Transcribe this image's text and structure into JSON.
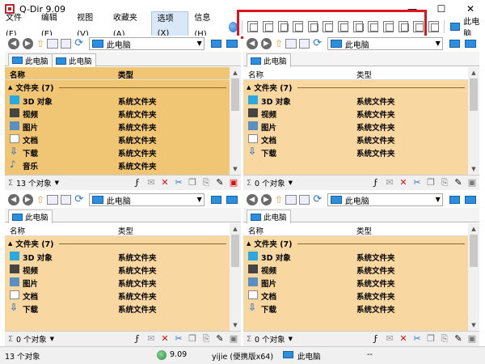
{
  "app": {
    "title": "Q-Dir 9.09"
  },
  "menu": [
    "文件(F)",
    "编辑(E)",
    "视图(V)",
    "收藏夹(A)",
    "选项(X)",
    "信息(H)"
  ],
  "toolbar": {
    "location_label": "此电脑"
  },
  "panes": [
    {
      "address": "此电脑",
      "tabs": [
        "此电脑",
        "此电脑"
      ],
      "columns": {
        "name": "名称",
        "type": "类型"
      },
      "group": "文件夹 (7)",
      "rows": [
        {
          "name": "3D 对象",
          "type": "系统文件夹",
          "icon": "3d-objects-icon"
        },
        {
          "name": "视频",
          "type": "系统文件夹",
          "icon": "video-icon"
        },
        {
          "name": "图片",
          "type": "系统文件夹",
          "icon": "pictures-icon"
        },
        {
          "name": "文档",
          "type": "系统文件夹",
          "icon": "documents-icon"
        },
        {
          "name": "下载",
          "type": "系统文件夹",
          "icon": "download-icon"
        },
        {
          "name": "音乐",
          "type": "系统文件夹",
          "icon": "music-icon"
        }
      ],
      "status": "13 个对象"
    },
    {
      "address": "此电脑",
      "tabs": [
        "此电脑"
      ],
      "columns": {
        "name": "名称",
        "type": "类型"
      },
      "group": "文件夹 (7)",
      "rows": [
        {
          "name": "3D 对象",
          "type": "系统文件夹",
          "icon": "3d-objects-icon"
        },
        {
          "name": "视频",
          "type": "系统文件夹",
          "icon": "video-icon"
        },
        {
          "name": "图片",
          "type": "系统文件夹",
          "icon": "pictures-icon"
        },
        {
          "name": "文档",
          "type": "系统文件夹",
          "icon": "documents-icon"
        },
        {
          "name": "下载",
          "type": "系统文件夹",
          "icon": "download-icon"
        }
      ],
      "status": "0 个对象"
    },
    {
      "address": "此电脑",
      "tabs": [
        "此电脑"
      ],
      "columns": {
        "name": "名称",
        "type": "类型"
      },
      "group": "文件夹 (7)",
      "rows": [
        {
          "name": "3D 对象",
          "type": "系统文件夹",
          "icon": "3d-objects-icon"
        },
        {
          "name": "视频",
          "type": "系统文件夹",
          "icon": "video-icon"
        },
        {
          "name": "图片",
          "type": "系统文件夹",
          "icon": "pictures-icon"
        },
        {
          "name": "文档",
          "type": "系统文件夹",
          "icon": "documents-icon"
        },
        {
          "name": "下载",
          "type": "系统文件夹",
          "icon": "download-icon"
        }
      ],
      "status": "0 个对象"
    },
    {
      "address": "此电脑",
      "tabs": [
        "此电脑"
      ],
      "columns": {
        "name": "名称",
        "type": "类型"
      },
      "group": "文件夹 (7)",
      "rows": [
        {
          "name": "3D 对象",
          "type": "系统文件夹",
          "icon": "3d-objects-icon"
        },
        {
          "name": "视频",
          "type": "系统文件夹",
          "icon": "video-icon"
        },
        {
          "name": "图片",
          "type": "系统文件夹",
          "icon": "pictures-icon"
        },
        {
          "name": "文档",
          "type": "系统文件夹",
          "icon": "documents-icon"
        },
        {
          "name": "下载",
          "type": "系统文件夹",
          "icon": "download-icon"
        }
      ],
      "status": "0 个对象"
    }
  ],
  "statusbar": {
    "count": "13 个对象",
    "version": "9.09",
    "user": "yijie (便携版x64)",
    "location": "此电脑",
    "extra": "--"
  },
  "colors": {
    "highlight": "#e0141e",
    "active_pane": "#f0c674",
    "pane": "#f9d7a0"
  }
}
